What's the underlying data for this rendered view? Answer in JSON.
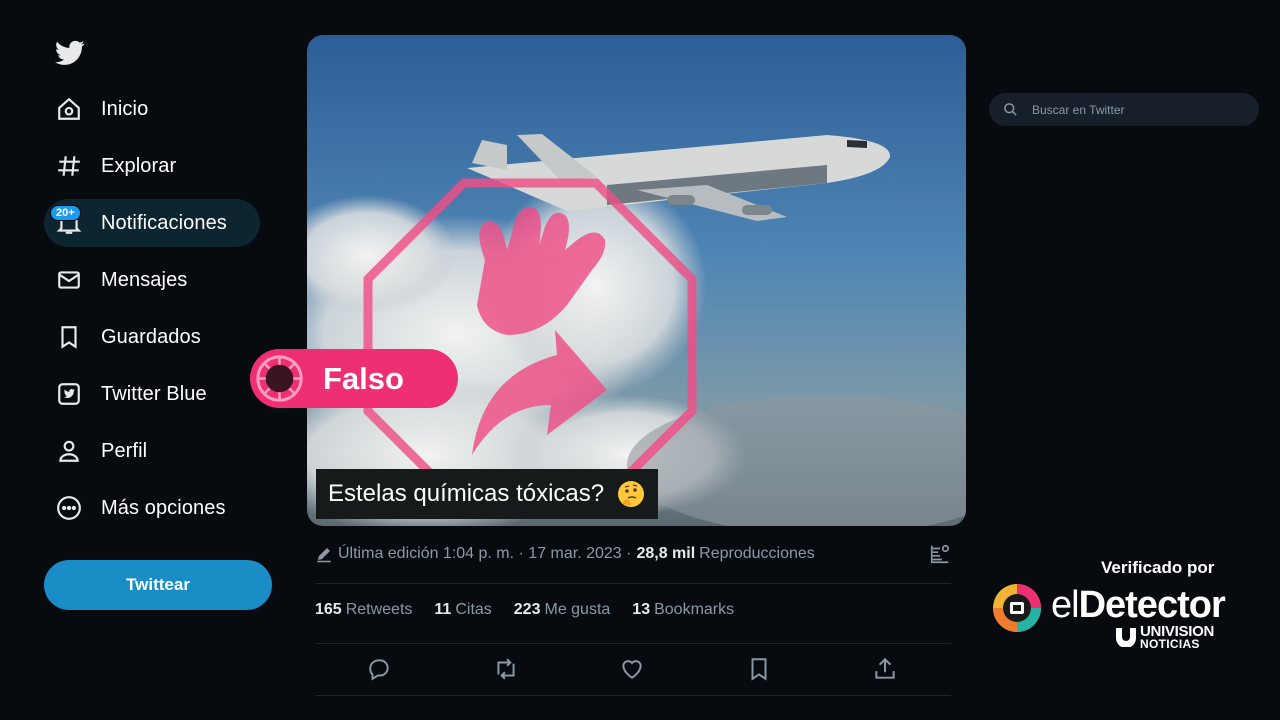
{
  "app": {
    "name": "Twitter",
    "logo_icon": "twitter-bird-icon"
  },
  "sidebar": {
    "items": [
      {
        "label": "Inicio",
        "icon": "home-icon"
      },
      {
        "label": "Explorar",
        "icon": "hashtag-icon"
      },
      {
        "label": "Notificaciones",
        "icon": "bell-icon",
        "badge": "20+",
        "active": true
      },
      {
        "label": "Mensajes",
        "icon": "envelope-icon"
      },
      {
        "label": "Guardados",
        "icon": "bookmark-icon"
      },
      {
        "label": "Twitter Blue",
        "icon": "twitter-blue-icon"
      },
      {
        "label": "Perfil",
        "icon": "person-icon"
      },
      {
        "label": "Más opciones",
        "icon": "more-circle-icon"
      }
    ],
    "tweet_button": "Twittear"
  },
  "search": {
    "placeholder": "Buscar en Twitter"
  },
  "tweet": {
    "caption": "Estelas químicas tóxicas?",
    "caption_emoji": "thinking-face",
    "meta": {
      "edited": "Última edición 1:04 p. m. · 17 mar. 2023 ·",
      "views_count": "28,8 mil",
      "views_label": "Reproducciones"
    },
    "stats": [
      {
        "num": "165",
        "label": "Retweets"
      },
      {
        "num": "11",
        "label": "Citas"
      },
      {
        "num": "223",
        "label": "Me gusta"
      },
      {
        "num": "13",
        "label": "Bookmarks"
      }
    ],
    "actions": [
      "reply-icon",
      "retweet-icon",
      "like-icon",
      "bookmark-icon",
      "share-icon"
    ]
  },
  "fact_check": {
    "verdict": "Falso",
    "verified_by": "Verificado por",
    "brand_prefix": "el",
    "brand_name": "Detector",
    "network_line1": "UNIVISION",
    "network_line2": "NOTICIAS"
  },
  "colors": {
    "background": "#070b0f",
    "accent": "#1d9bf0",
    "tweet_button": "#1a8cc6",
    "verdict_pink": "#ef2f74",
    "muted_text": "#8b98a5"
  }
}
